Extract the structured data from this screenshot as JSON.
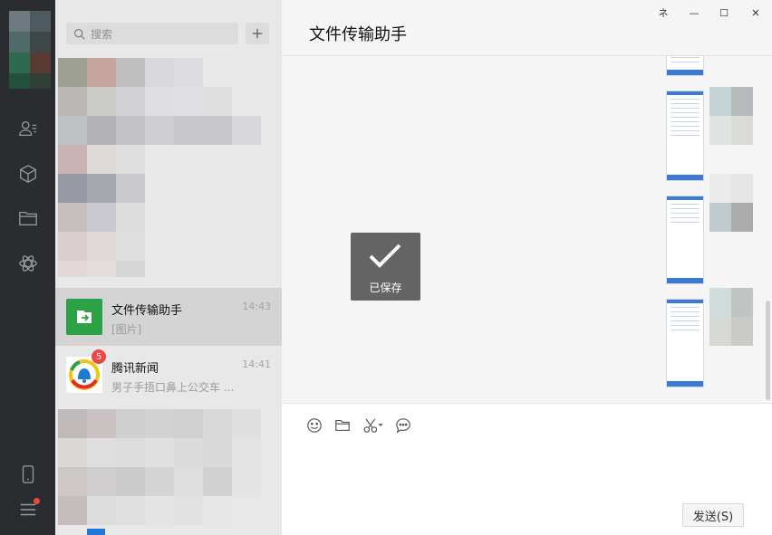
{
  "search": {
    "placeholder": "搜索"
  },
  "chats": [
    {
      "name": "文件传输助手",
      "time": "14:43",
      "preview": "[图片]",
      "active": true
    },
    {
      "name": "腾讯新闻",
      "time": "14:41",
      "preview": "男子手捂口鼻上公交车 ...",
      "badge": "5"
    }
  ],
  "panel": {
    "title": "文件传输助手"
  },
  "window_controls": {
    "pin": "ネ",
    "minimize": "—",
    "maximize": "☐",
    "close": "✕"
  },
  "toast": {
    "text": "已保存"
  },
  "composer": {
    "send_label": "发送(S)"
  },
  "icons": {
    "rail": [
      "contacts-icon",
      "mini-program-icon",
      "folder-icon",
      "moments-icon",
      "phone-icon",
      "menu-icon"
    ],
    "tools": [
      "emoji-icon",
      "file-icon",
      "screenshot-icon",
      "chat-history-icon"
    ]
  },
  "colors": {
    "file_helper_green": "#2ba245",
    "badge_red": "#f04545",
    "rail_bg": "#2b2c2f"
  }
}
